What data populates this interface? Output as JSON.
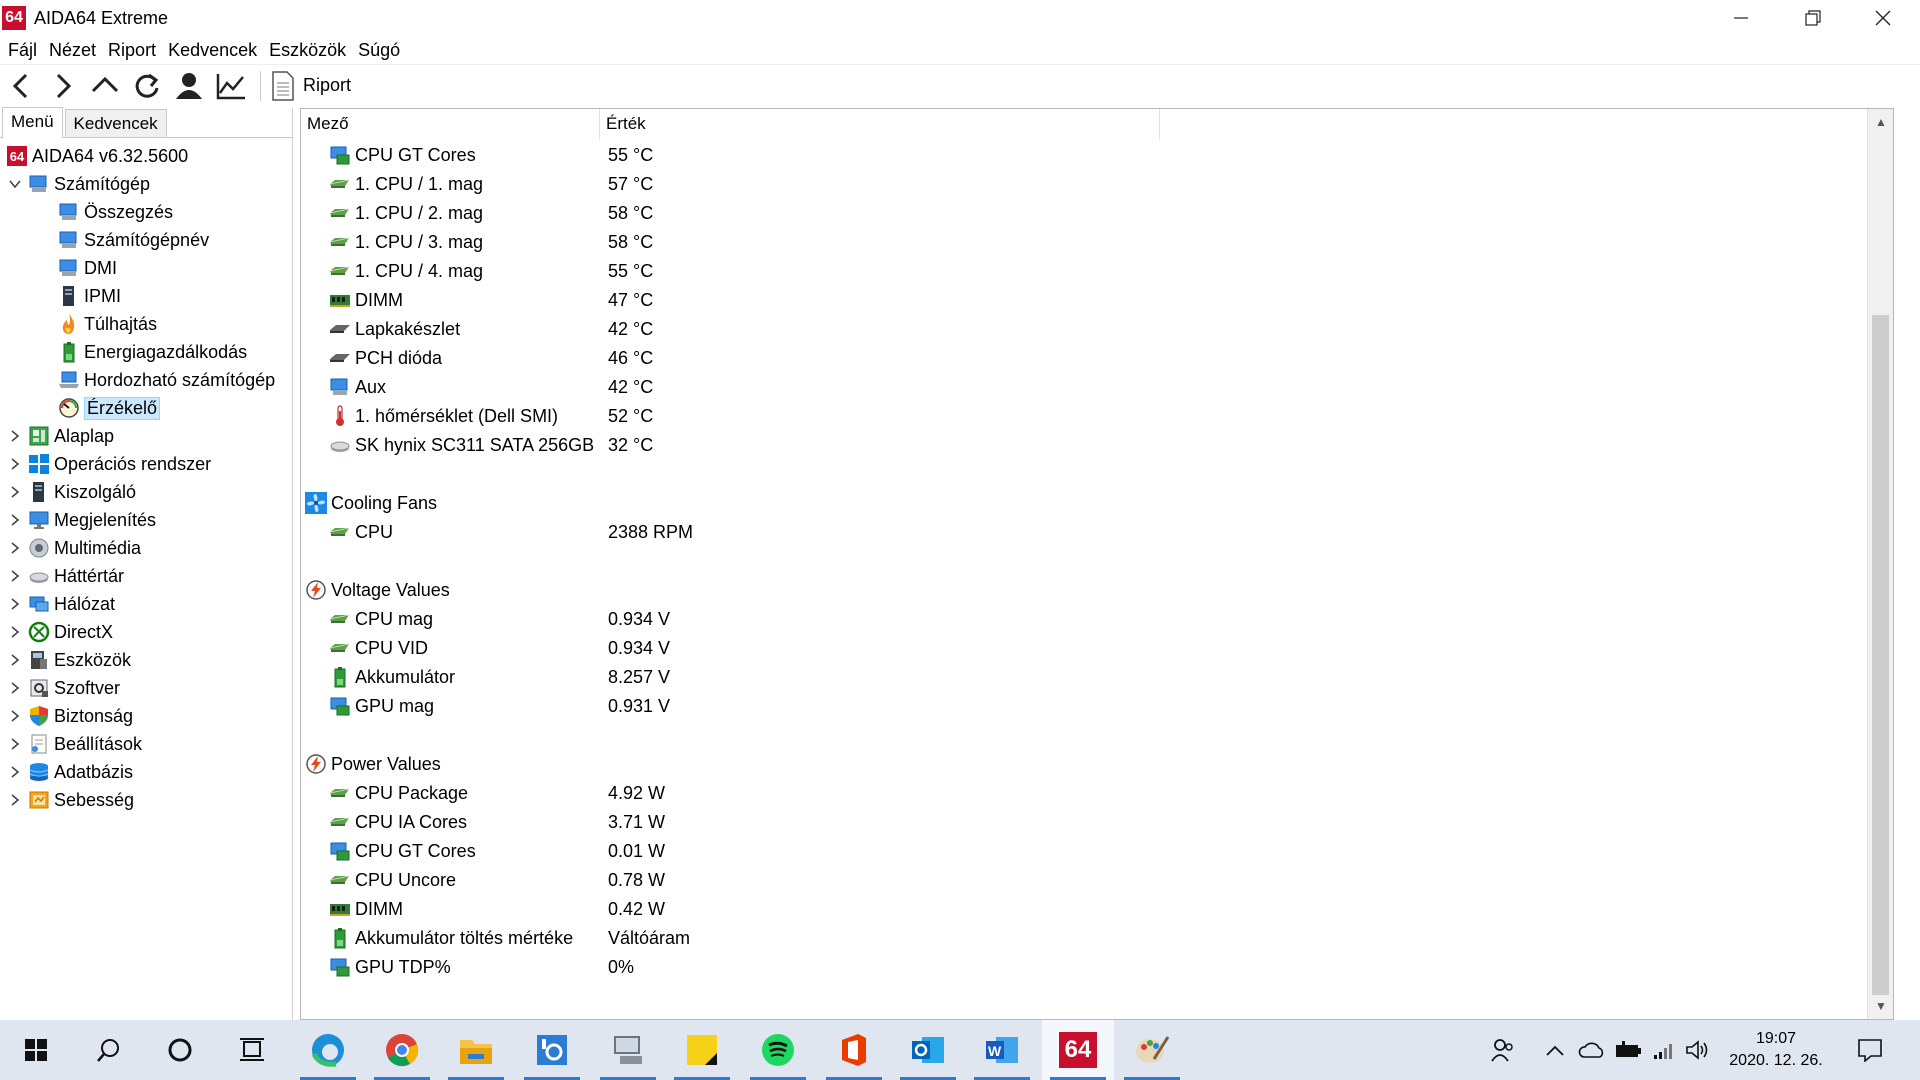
{
  "window": {
    "logo": "64",
    "title": "AIDA64 Extreme",
    "minimize": "—",
    "restore": "❐",
    "close": "✕"
  },
  "menubar": [
    "Fájl",
    "Nézet",
    "Riport",
    "Kedvencek",
    "Eszközök",
    "Súgó"
  ],
  "toolbar": {
    "icons": [
      "back-icon",
      "forward-icon",
      "up-icon",
      "refresh-icon",
      "user-icon",
      "chart-icon"
    ],
    "report_label": "Riport"
  },
  "left_panel": {
    "tabs": [
      "Menü",
      "Kedvencek"
    ],
    "tree": [
      {
        "label": "AIDA64 v6.32.5600",
        "level": 0,
        "expander": "",
        "icon": "aida64-logo-icon"
      },
      {
        "label": "Számítógép",
        "level": 1,
        "expander": "v",
        "icon": "computer-icon"
      },
      {
        "label": "Összegzés",
        "level": 2,
        "expander": "",
        "icon": "computer-icon"
      },
      {
        "label": "Számítógépnév",
        "level": 2,
        "expander": "",
        "icon": "computer-icon"
      },
      {
        "label": "DMI",
        "level": 2,
        "expander": "",
        "icon": "computer-icon"
      },
      {
        "label": "IPMI",
        "level": 2,
        "expander": "",
        "icon": "server-icon"
      },
      {
        "label": "Túlhajtás",
        "level": 2,
        "expander": "",
        "icon": "flame-icon"
      },
      {
        "label": "Energiagazdálkodás",
        "level": 2,
        "expander": "",
        "icon": "battery-icon"
      },
      {
        "label": "Hordozható számítógép",
        "level": 2,
        "expander": "",
        "icon": "laptop-icon"
      },
      {
        "label": "Érzékelő",
        "level": 2,
        "expander": "",
        "icon": "gauge-icon",
        "selected": true
      },
      {
        "label": "Alaplap",
        "level": 1,
        "expander": ">",
        "icon": "motherboard-icon"
      },
      {
        "label": "Operációs rendszer",
        "level": 1,
        "expander": ">",
        "icon": "windows-icon"
      },
      {
        "label": "Kiszolgáló",
        "level": 1,
        "expander": ">",
        "icon": "server-icon"
      },
      {
        "label": "Megjelenítés",
        "level": 1,
        "expander": ">",
        "icon": "monitor-icon"
      },
      {
        "label": "Multimédia",
        "level": 1,
        "expander": ">",
        "icon": "speaker-icon"
      },
      {
        "label": "Háttértár",
        "level": 1,
        "expander": ">",
        "icon": "disk-icon"
      },
      {
        "label": "Hálózat",
        "level": 1,
        "expander": ">",
        "icon": "network-icon"
      },
      {
        "label": "DirectX",
        "level": 1,
        "expander": ">",
        "icon": "xbox-icon"
      },
      {
        "label": "Eszközök",
        "level": 1,
        "expander": ">",
        "icon": "devices-icon"
      },
      {
        "label": "Szoftver",
        "level": 1,
        "expander": ">",
        "icon": "software-icon"
      },
      {
        "label": "Biztonság",
        "level": 1,
        "expander": ">",
        "icon": "shield-icon"
      },
      {
        "label": "Beállítások",
        "level": 1,
        "expander": ">",
        "icon": "settings-icon"
      },
      {
        "label": "Adatbázis",
        "level": 1,
        "expander": ">",
        "icon": "database-icon"
      },
      {
        "label": "Sebesség",
        "level": 1,
        "expander": ">",
        "icon": "benchmark-icon"
      }
    ]
  },
  "table": {
    "columns": [
      "Mező",
      "Érték"
    ],
    "rows": [
      {
        "type": "item",
        "field": "CPU GT Cores",
        "value": "55 °C",
        "icon": "gpu-icon"
      },
      {
        "type": "item",
        "field": "1. CPU / 1. mag",
        "value": "57 °C",
        "icon": "cpu-icon"
      },
      {
        "type": "item",
        "field": "1. CPU / 2. mag",
        "value": "58 °C",
        "icon": "cpu-icon"
      },
      {
        "type": "item",
        "field": "1. CPU / 3. mag",
        "value": "58 °C",
        "icon": "cpu-icon"
      },
      {
        "type": "item",
        "field": "1. CPU / 4. mag",
        "value": "55 °C",
        "icon": "cpu-icon"
      },
      {
        "type": "item",
        "field": "DIMM",
        "value": "47 °C",
        "icon": "memory-icon"
      },
      {
        "type": "item",
        "field": "Lapkakészlet",
        "value": "42 °C",
        "icon": "chipset-icon"
      },
      {
        "type": "item",
        "field": "PCH dióda",
        "value": "46 °C",
        "icon": "chipset-icon"
      },
      {
        "type": "item",
        "field": "Aux",
        "value": "42 °C",
        "icon": "computer-icon"
      },
      {
        "type": "item",
        "field": "1. hőmérséklet (Dell SMI)",
        "value": "52 °C",
        "icon": "thermometer-icon"
      },
      {
        "type": "item",
        "field": "SK hynix SC311 SATA 256GB",
        "value": "32 °C",
        "icon": "disk-icon"
      },
      {
        "type": "blank"
      },
      {
        "type": "section",
        "field": "Cooling Fans",
        "icon": "fan-icon"
      },
      {
        "type": "item",
        "field": "CPU",
        "value": "2388 RPM",
        "icon": "cpu-icon"
      },
      {
        "type": "blank"
      },
      {
        "type": "section",
        "field": "Voltage Values",
        "icon": "lightning-icon"
      },
      {
        "type": "item",
        "field": "CPU mag",
        "value": "0.934 V",
        "icon": "cpu-icon"
      },
      {
        "type": "item",
        "field": "CPU VID",
        "value": "0.934 V",
        "icon": "cpu-icon"
      },
      {
        "type": "item",
        "field": "Akkumulátor",
        "value": "8.257 V",
        "icon": "battery-icon"
      },
      {
        "type": "item",
        "field": "GPU mag",
        "value": "0.931 V",
        "icon": "gpu-icon"
      },
      {
        "type": "blank"
      },
      {
        "type": "section",
        "field": "Power Values",
        "icon": "lightning-icon"
      },
      {
        "type": "item",
        "field": "CPU Package",
        "value": "4.92 W",
        "icon": "cpu-icon"
      },
      {
        "type": "item",
        "field": "CPU IA Cores",
        "value": "3.71 W",
        "icon": "cpu-icon"
      },
      {
        "type": "item",
        "field": "CPU GT Cores",
        "value": "0.01 W",
        "icon": "gpu-icon"
      },
      {
        "type": "item",
        "field": "CPU Uncore",
        "value": "0.78 W",
        "icon": "cpu-icon"
      },
      {
        "type": "item",
        "field": "DIMM",
        "value": "0.42 W",
        "icon": "memory-icon"
      },
      {
        "type": "item",
        "field": "Akkumulátor töltés mértéke",
        "value": "Váltóáram",
        "icon": "battery-icon"
      },
      {
        "type": "item",
        "field": "GPU TDP%",
        "value": "0%",
        "icon": "gpu-icon"
      }
    ]
  },
  "taskbar": {
    "apps": [
      {
        "name": "windows-start-icon",
        "open": false,
        "active": false
      },
      {
        "name": "search-icon",
        "open": false,
        "active": false
      },
      {
        "name": "cortana-icon",
        "open": false,
        "active": false
      },
      {
        "name": "task-view-icon",
        "open": false,
        "active": false
      },
      {
        "name": "edge-icon",
        "open": true,
        "active": false
      },
      {
        "name": "chrome-icon",
        "open": true,
        "active": false
      },
      {
        "name": "file-explorer-icon",
        "open": true,
        "active": false
      },
      {
        "name": "control-panel-icon",
        "open": true,
        "active": false
      },
      {
        "name": "device-manager-icon",
        "open": true,
        "active": false
      },
      {
        "name": "sticky-notes-icon",
        "open": true,
        "active": false
      },
      {
        "name": "spotify-icon",
        "open": true,
        "active": false
      },
      {
        "name": "office-icon",
        "open": true,
        "active": false
      },
      {
        "name": "outlook-icon",
        "open": true,
        "active": false
      },
      {
        "name": "word-icon",
        "open": true,
        "active": false
      },
      {
        "name": "aida64-icon",
        "open": true,
        "active": true
      },
      {
        "name": "paint-icon",
        "open": true,
        "active": false
      }
    ],
    "aida_label": "64",
    "tray_icons": [
      "people-icon",
      "chevron-up-icon",
      "onedrive-icon",
      "battery-icon",
      "wifi-icon",
      "volume-icon"
    ],
    "time": "19:07",
    "date": "2020. 12. 26.",
    "notification_icon": "notification-icon"
  },
  "colors": {
    "aida_red": "#c8102e",
    "selection": "#cce8ff",
    "taskbar": "#dfe6ef",
    "accent": "#2f7ad1"
  }
}
